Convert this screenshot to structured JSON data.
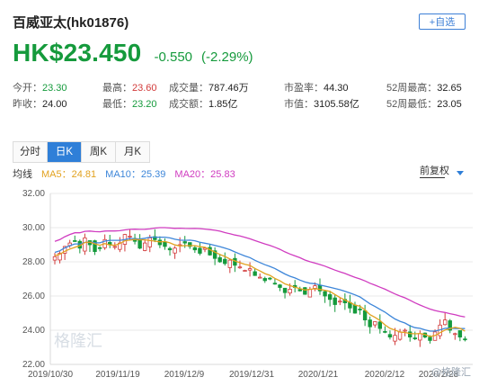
{
  "header": {
    "title": "百威亚太(hk01876)",
    "watch_button": "+自选"
  },
  "quote": {
    "price": "HK$23.450",
    "change": "-0.550",
    "change_pct": "(-2.29%)"
  },
  "stats": {
    "row1": [
      {
        "label": "今开：",
        "value": "23.30",
        "tone": "green"
      },
      {
        "label": "最高：",
        "value": "23.60",
        "tone": "red"
      },
      {
        "label": "成交量：",
        "value": "787.46万",
        "tone": "plain"
      },
      {
        "label": "市盈率：",
        "value": "44.30",
        "tone": "plain"
      },
      {
        "label": "52周最高：",
        "value": "32.65",
        "tone": "plain"
      }
    ],
    "row2": [
      {
        "label": "昨收：",
        "value": "24.00",
        "tone": "plain"
      },
      {
        "label": "最低：",
        "value": "23.20",
        "tone": "green"
      },
      {
        "label": "成交额：",
        "value": "1.85亿",
        "tone": "plain"
      },
      {
        "label": "市值：",
        "value": "3105.58亿",
        "tone": "plain"
      },
      {
        "label": "52周最低：",
        "value": "23.05",
        "tone": "plain"
      }
    ]
  },
  "tabs": [
    {
      "label": "分时",
      "active": false
    },
    {
      "label": "日K",
      "active": true
    },
    {
      "label": "周K",
      "active": false
    },
    {
      "label": "月K",
      "active": false
    }
  ],
  "ma_legend": {
    "title": "均线",
    "ma5": "MA5：24.81",
    "ma10": "MA10：25.39",
    "ma20": "MA20：25.83"
  },
  "adjust_dropdown": {
    "label": "前复权"
  },
  "watermarks": {
    "center": "格隆汇",
    "corner": "@格隆汇"
  },
  "colors": {
    "up": "#d23a3a",
    "down": "#159a3c",
    "ma5": "#e2a21f",
    "ma10": "#3d86d9",
    "ma20": "#d03cc0",
    "accent": "#2f7fd8"
  },
  "chart_data": {
    "type": "candlestick",
    "title": "",
    "xlabel": "",
    "ylabel": "",
    "ylim": [
      22,
      32
    ],
    "yticks": [
      "32.00",
      "30.00",
      "28.00",
      "26.00",
      "24.00",
      "22.00"
    ],
    "xticks": [
      "2019/10/30",
      "2019/11/19",
      "2019/12/9",
      "2019/12/31",
      "2020/1/21",
      "2020/2/12",
      "2020/2/28"
    ],
    "close": [
      28.3,
      28.5,
      28.9,
      29.1,
      29.2,
      28.8,
      29.4,
      29.0,
      28.6,
      28.8,
      29.3,
      29.0,
      28.9,
      29.1,
      29.6,
      29.5,
      29.2,
      28.8,
      29.1,
      29.4,
      29.3,
      29.0,
      28.9,
      28.7,
      28.8,
      29.0,
      29.1,
      28.9,
      28.7,
      28.5,
      28.8,
      28.4,
      28.2,
      28.0,
      27.9,
      28.1,
      27.8,
      27.7,
      27.5,
      27.6,
      27.2,
      27.1,
      26.9,
      27.0,
      26.7,
      26.5,
      26.2,
      26.4,
      26.5,
      26.3,
      26.1,
      26.4,
      26.6,
      26.3,
      26.0,
      25.8,
      25.5,
      25.7,
      25.6,
      25.3,
      25.0,
      25.2,
      24.6,
      24.2,
      24.5,
      24.1,
      23.9,
      23.6,
      23.7,
      23.9,
      24.0,
      23.6,
      23.5,
      23.8,
      23.6,
      23.4,
      23.9,
      24.3,
      24.6,
      24.0,
      23.8,
      23.6,
      23.45
    ],
    "ma5_last": 24.81,
    "ma10_last": 25.39,
    "ma20_last": 25.83
  }
}
